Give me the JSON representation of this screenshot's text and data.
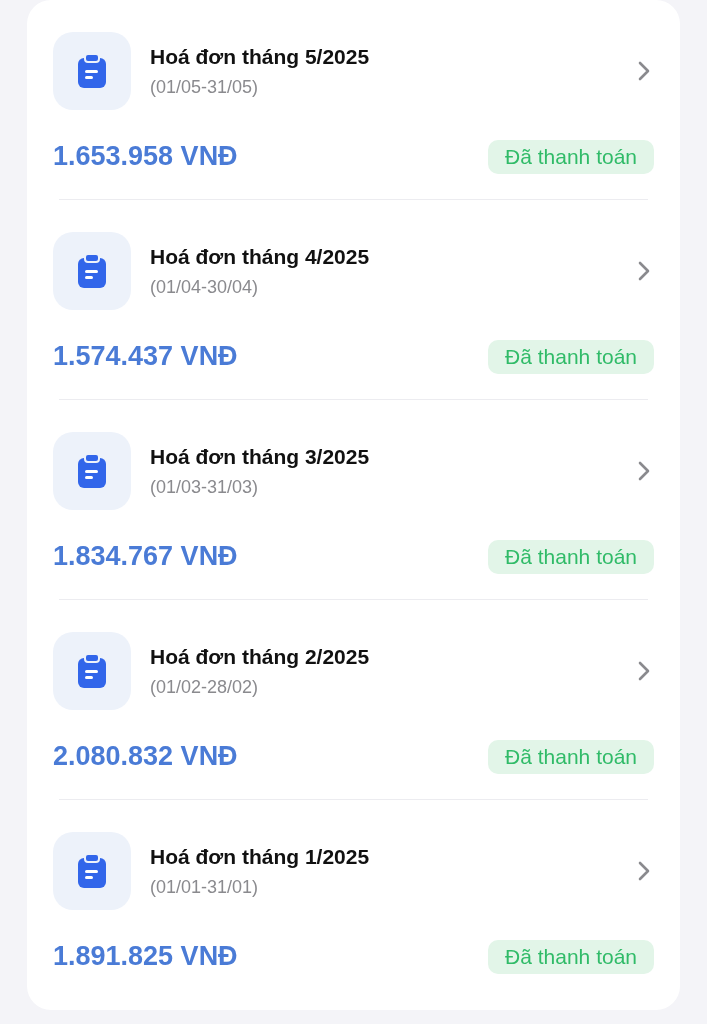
{
  "invoices": [
    {
      "title": "Hoá đơn tháng 5/2025",
      "period": "(01/05-31/05)",
      "amount": "1.653.958 VNĐ",
      "status": {
        "label": "Đã thanh toán",
        "kind": "paid"
      }
    },
    {
      "title": "Hoá đơn tháng 4/2025",
      "period": "(01/04-30/04)",
      "amount": "1.574.437 VNĐ",
      "status": {
        "label": "Đã thanh toán",
        "kind": "paid"
      }
    },
    {
      "title": "Hoá đơn tháng 3/2025",
      "period": "(01/03-31/03)",
      "amount": "1.834.767 VNĐ",
      "status": {
        "label": "Đã thanh toán",
        "kind": "paid"
      }
    },
    {
      "title": "Hoá đơn tháng 2/2025",
      "period": "(01/02-28/02)",
      "amount": "2.080.832 VNĐ",
      "status": {
        "label": "Đã thanh toán",
        "kind": "paid"
      }
    },
    {
      "title": "Hoá đơn tháng 1/2025",
      "period": "(01/01-31/01)",
      "amount": "1.891.825 VNĐ",
      "status": {
        "label": "Đã thanh toán",
        "kind": "paid"
      }
    }
  ]
}
